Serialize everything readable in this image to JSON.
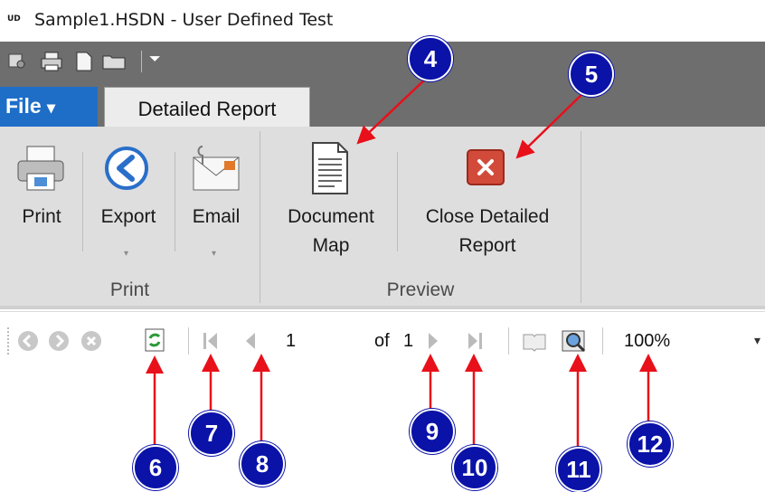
{
  "window": {
    "app_icon_text": "UD",
    "title": "Sample1.HSDN - User Defined Test"
  },
  "qat": {
    "overflow_glyph": "⏷"
  },
  "tabs": {
    "file_label": "File",
    "file_caret": "▾",
    "active_label": "Detailed Report"
  },
  "ribbon": {
    "print_group_label": "Print",
    "preview_group_label": "Preview",
    "print_button": "Print",
    "export_button": "Export",
    "email_button": "Email",
    "docmap_line1": "Document",
    "docmap_line2": "Map",
    "close_line1": "Close Detailed",
    "close_line2": "Report",
    "caret": "▾"
  },
  "navbar": {
    "current_page": "1",
    "of_label": "of",
    "total_pages": "1",
    "zoom_value": "100%",
    "zoom_caret": "▾"
  },
  "callouts": [
    "4",
    "5",
    "6",
    "7",
    "8",
    "9",
    "10",
    "11",
    "12"
  ],
  "colors": {
    "callout": "#0a12a8",
    "arrow": "#e8101a",
    "file_tab": "#1e6ec8",
    "ribbon": "#dedede",
    "qat": "#6e6e6e"
  }
}
